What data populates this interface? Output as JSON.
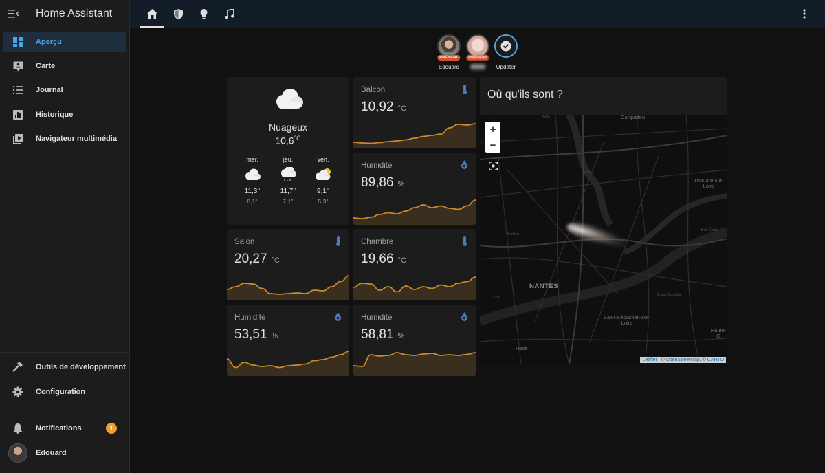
{
  "app": {
    "title": "Home Assistant"
  },
  "sidebar": {
    "items": [
      {
        "label": "Aperçu",
        "icon": "dashboard-icon"
      },
      {
        "label": "Carte",
        "icon": "map-marker-icon"
      },
      {
        "label": "Journal",
        "icon": "list-icon"
      },
      {
        "label": "Historique",
        "icon": "chart-bar-icon"
      },
      {
        "label": "Navigateur multimédia",
        "icon": "play-box-icon"
      }
    ],
    "bottom_items": [
      {
        "label": "Outils de développement",
        "icon": "hammer-icon"
      },
      {
        "label": "Configuration",
        "icon": "gear-icon"
      }
    ],
    "notifications": {
      "label": "Notifications",
      "count": "1"
    },
    "user": {
      "name": "Edouard"
    }
  },
  "colors": {
    "accent": "#4fa3e0",
    "graph": "#c98a2c",
    "badge_present": "#d4552d",
    "notif_badge": "#f0a033"
  },
  "badges": [
    {
      "name": "Edouard",
      "tag": "PRÉSENT"
    },
    {
      "name": "",
      "tag": "PRÉSENT"
    },
    {
      "name": "Updater",
      "tag": ""
    }
  ],
  "weather": {
    "condition": "Nuageux",
    "temperature": "10,6",
    "unit": "°C",
    "forecast": [
      {
        "day": "mer.",
        "high": "11,3°",
        "low": "8,1°"
      },
      {
        "day": "jeu.",
        "high": "11,7°",
        "low": "7,1°"
      },
      {
        "day": "ven.",
        "high": "9,1°",
        "low": "5,3°"
      }
    ]
  },
  "sensors": [
    {
      "name": "Balcon",
      "value": "10,92",
      "unit": "°C",
      "icon": "thermometer-icon",
      "trend": [
        0.18,
        0.16,
        0.15,
        0.17,
        0.2,
        0.22,
        0.25,
        0.3,
        0.35,
        0.38,
        0.42,
        0.6,
        0.7,
        0.68,
        0.72
      ]
    },
    {
      "name": "Humidité",
      "value": "89,86",
      "unit": "%",
      "icon": "water-drop-icon",
      "trend": [
        0.2,
        0.18,
        0.22,
        0.3,
        0.35,
        0.32,
        0.4,
        0.5,
        0.58,
        0.5,
        0.55,
        0.48,
        0.45,
        0.55,
        0.72
      ]
    },
    {
      "name": "Salon",
      "value": "20,27",
      "unit": "°C",
      "icon": "thermometer-icon",
      "trend": [
        0.32,
        0.4,
        0.5,
        0.48,
        0.35,
        0.2,
        0.18,
        0.2,
        0.22,
        0.2,
        0.3,
        0.28,
        0.4,
        0.55,
        0.72
      ]
    },
    {
      "name": "Chambre",
      "value": "19,66",
      "unit": "°C",
      "icon": "thermometer-icon",
      "trend": [
        0.38,
        0.5,
        0.48,
        0.3,
        0.4,
        0.25,
        0.42,
        0.32,
        0.4,
        0.35,
        0.45,
        0.4,
        0.5,
        0.55,
        0.68
      ]
    },
    {
      "name": "Humidité",
      "value": "53,51",
      "unit": "%",
      "icon": "water-drop-icon",
      "trend": [
        0.5,
        0.25,
        0.4,
        0.32,
        0.28,
        0.3,
        0.25,
        0.3,
        0.32,
        0.35,
        0.45,
        0.48,
        0.55,
        0.62,
        0.72
      ]
    },
    {
      "name": "Humidité",
      "value": "58,81",
      "unit": "%",
      "icon": "water-drop-icon",
      "trend": [
        0.3,
        0.28,
        0.62,
        0.58,
        0.6,
        0.68,
        0.62,
        0.6,
        0.64,
        0.66,
        0.6,
        0.62,
        0.6,
        0.63,
        0.68
      ]
    }
  ],
  "map": {
    "title": "Où qu'ils sont ?",
    "zoom_in": "+",
    "zoom_out": "−",
    "places": [
      "Carquefou",
      "Thouaré-sur-Loire",
      "Barbine",
      "NANTES",
      "Basse-Goulaine",
      "Saint-Sébastien-sur-Loire",
      "Rezé",
      "Haute-G",
      "Brûlé",
      "Zola",
      "Bois Colas",
      "Erdre"
    ],
    "attribution": {
      "leaflet": "Leaflet",
      "sep": " | © ",
      "osm": "OpenStreetMap",
      "sep2": ", © ",
      "carto": "CARTO"
    }
  }
}
